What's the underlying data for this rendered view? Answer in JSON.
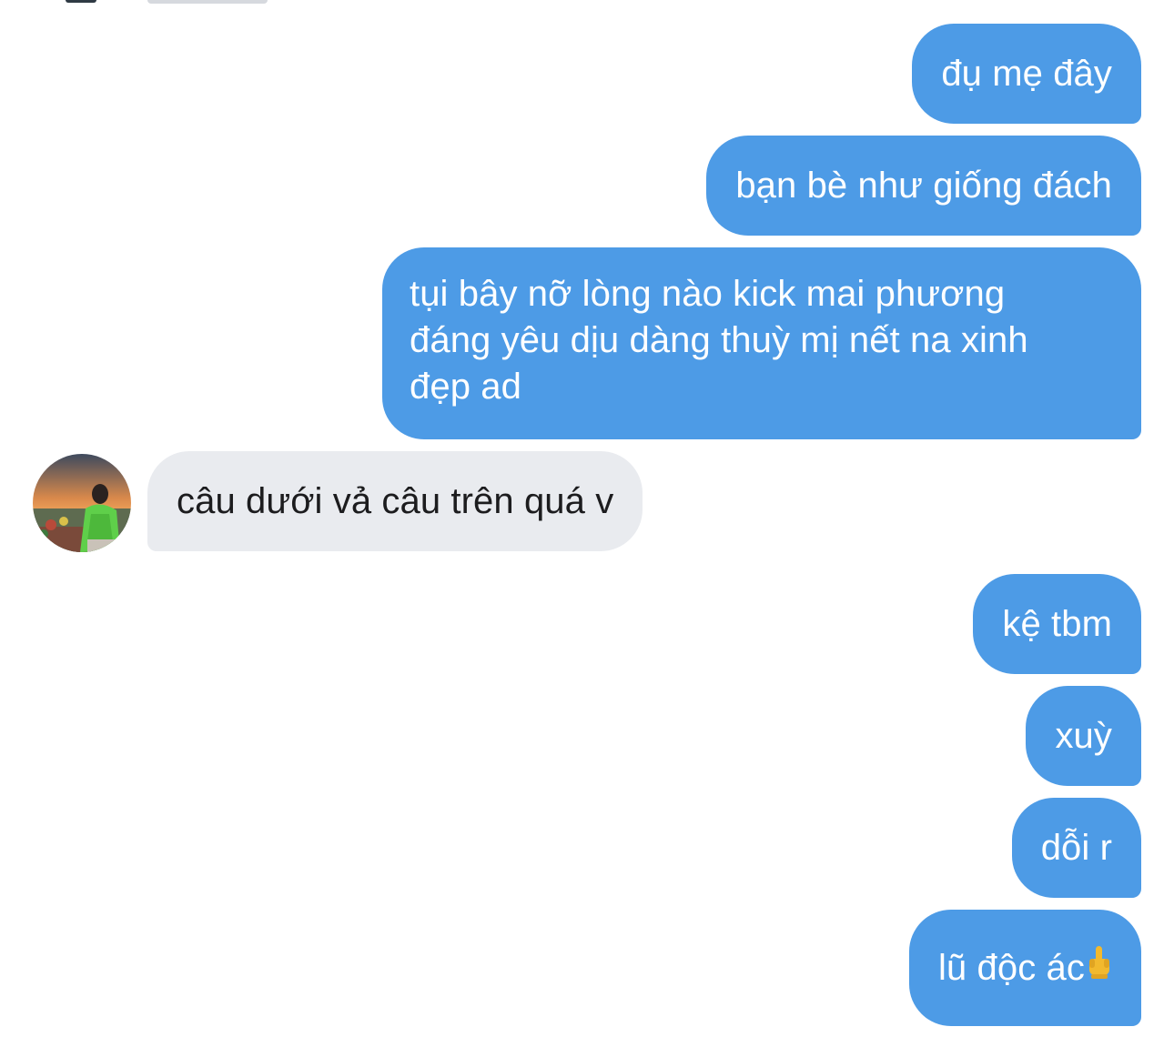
{
  "conversation": {
    "messages": [
      {
        "direction": "outgoing",
        "text": "đụ mẹ đây"
      },
      {
        "direction": "outgoing",
        "text": "bạn bè như giống đách"
      },
      {
        "direction": "outgoing",
        "lines": [
          "tụi bây nỡ lòng nào kick mai phương",
          "đáng yêu dịu dàng thuỳ mị nết na xinh",
          "đẹp ad"
        ]
      },
      {
        "direction": "incoming",
        "text": "câu dưới vả câu trên quá v",
        "avatar": "contact-avatar-photo"
      },
      {
        "direction": "outgoing",
        "text": "kệ tbm"
      },
      {
        "direction": "outgoing",
        "text": "xuỳ"
      },
      {
        "direction": "outgoing",
        "text": "dỗi r"
      },
      {
        "direction": "outgoing",
        "text": "lũ độc ác",
        "emoji": "middle-finger-emoji"
      }
    ]
  },
  "colors": {
    "outgoing_bubble": "#4d9be6",
    "incoming_bubble": "#e9ebef",
    "outgoing_text": "#ffffff",
    "incoming_text": "#1c1c1e"
  }
}
